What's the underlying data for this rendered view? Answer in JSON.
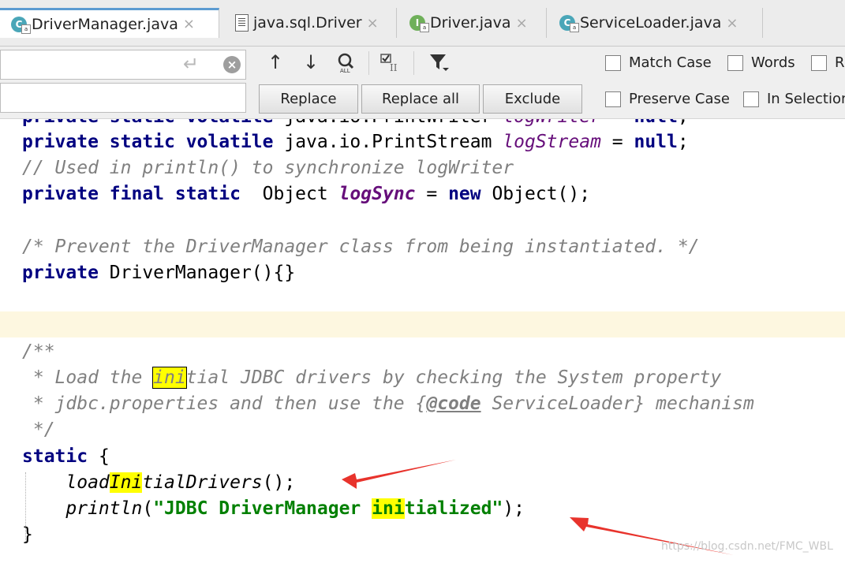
{
  "tabs": [
    {
      "label": "DriverManager.java",
      "icon": "class-icon",
      "active": true
    },
    {
      "label": "java.sql.Driver",
      "icon": "file-icon",
      "active": false
    },
    {
      "label": "Driver.java",
      "icon": "interface-icon",
      "active": false
    },
    {
      "label": "ServiceLoader.java",
      "icon": "class-icon",
      "active": false
    }
  ],
  "tab_close_glyph": "×",
  "find": {
    "search_value": "",
    "replace_value": "",
    "buttons": {
      "replace": "Replace",
      "replace_all": "Replace all",
      "exclude": "Exclude"
    },
    "options": {
      "match_case": "Match Case",
      "words": "Words",
      "regex_partial": "R",
      "preserve_case": "Preserve Case",
      "in_selection": "In Selection"
    }
  },
  "code": {
    "l0": {
      "a": "private static volatile ",
      "b": "java.io.PrintWriter ",
      "c": "logWriter",
      "d": " = ",
      "e": "null",
      "f": ";"
    },
    "l1": {
      "a": "private static volatile ",
      "b": "java.io.PrintStream ",
      "c": "logStream",
      "d": " = ",
      "e": "null",
      "f": ";"
    },
    "l2": {
      "a": "// Used in println() to synchronize logWriter"
    },
    "l3": {
      "a": "private final static ",
      "b": " Object ",
      "c": "logSync",
      "d": " = ",
      "e": "new",
      "f": " Object();"
    },
    "l4": {
      "a": "/* Prevent the DriverManager class from being instantiated. */"
    },
    "l5": {
      "a": "private ",
      "b": "DriverManager(){}"
    },
    "l6": {
      "a": "/**"
    },
    "l7": {
      "a": " * Load the ",
      "b": "ini",
      "c": "tial JDBC drivers by checking the System property"
    },
    "l8": {
      "a": " * jdbc.properties and then use the {",
      "b": "@code",
      "c": " ServiceLoader} mechanism"
    },
    "l9": {
      "a": " */"
    },
    "l10": {
      "a": "static",
      "b": " {"
    },
    "l11": {
      "a": "    ",
      "b": "load",
      "c": "Ini",
      "d": "tialDrivers",
      "e": "();"
    },
    "l12": {
      "a": "    ",
      "b": "println",
      "c": "(",
      "d": "\"JDBC DriverManager ",
      "e": "ini",
      "f": "tialized\"",
      "g": ");"
    },
    "l13": {
      "a": "}"
    }
  },
  "watermark": "https://blog.csdn.net/FMC_WBL",
  "colors": {
    "keyword": "#000080",
    "field": "#660e7a",
    "comment": "#808080",
    "string": "#008000",
    "highlight": "#ffff00",
    "arrow": "#e8332c",
    "caret_line": "#fdf7e0"
  }
}
